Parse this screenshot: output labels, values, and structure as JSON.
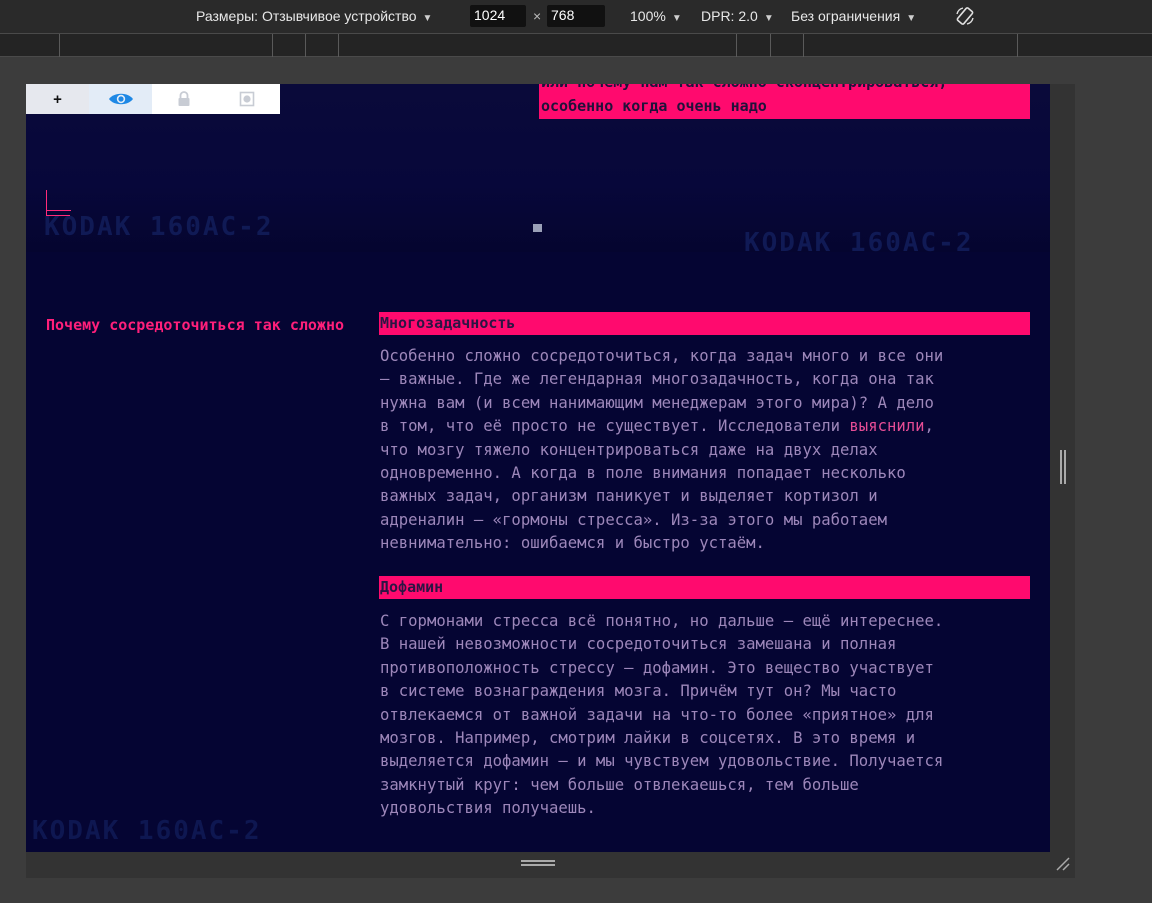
{
  "devtools": {
    "dimensions_label": "Размеры: Отзывчивое устройство",
    "width": "1024",
    "height": "768",
    "times": "×",
    "zoom": "100%",
    "dpr": "DPR: 2.0",
    "throttle": "Без ограничения"
  },
  "page": {
    "toolbar": {
      "add_label": "+",
      "icons": [
        "eye-icon",
        "lock-icon",
        "contrast-icon"
      ]
    },
    "subtitle_line1": "или почему нам так сложно сконцентрироваться,",
    "subtitle_line2": "особенно когда очень надо",
    "watermark": "KODAK 160AC-2",
    "left_title": "Почему сосредоточиться так сложно",
    "sections": [
      {
        "heading": "Многозадачность",
        "text_before": "Особенно сложно сосредоточиться, когда задач много и все они\n— важные. Где же легендарная многозадачность, когда она так\nнужна вам (и всем нанимающим менеджерам этого мира)? А дело\nв том, что её просто не существует. Исследователи ",
        "link": "выяснили",
        "text_after": ",\nчто мозгу тяжело концентрироваться даже на двух делах\nодновременно. А когда в поле внимания попадает несколько\nважных задач, организм паникует и выделяет кортизол и\nадреналин — «гормоны стресса». Из-за этого мы работаем\nневнимательно: ошибаемся и быстро устаём."
      },
      {
        "heading": "Дофамин",
        "text": "С гормонами стресса всё понятно, но дальше — ещё интереснее.\nВ нашей невозможности сосредоточиться замешана и полная\nпротивоположность стрессу — дофамин. Это вещество участвует\nв системе вознаграждения мозга. Причём тут он? Мы часто\nотвлекаемся от важной задачи на что-то более «приятное» для\nмозгов. Например, смотрим лайки в соцсетях. В это время и\nвыделяется дофамин — и мы чувствуем удовольствие. Получается\nзамкнутый круг: чем больше отвлекаешься, тем больше\nудовольствия получаешь."
      }
    ]
  },
  "colors": {
    "accent": "#ff0a6e",
    "background": "#050533",
    "text": "#9d87ba"
  }
}
